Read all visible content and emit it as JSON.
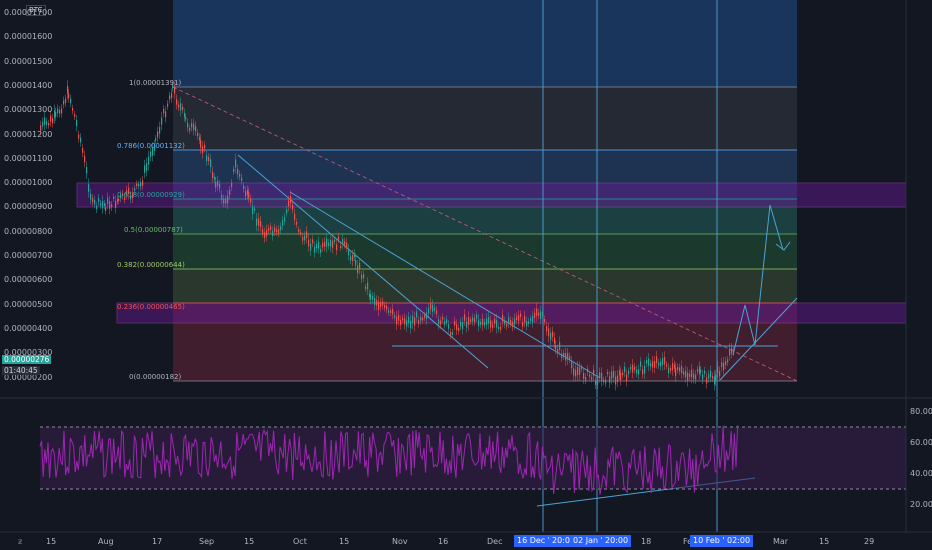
{
  "symbol": "BTC",
  "price_axis": [
    "0.00001700",
    "0.00001600",
    "0.00001500",
    "0.00001400",
    "0.00001300",
    "0.00001200",
    "0.00001100",
    "0.00001000",
    "0.00000900",
    "0.00000800",
    "0.00000700",
    "0.00000600",
    "0.00000500",
    "0.00000400",
    "0.00000300",
    "0.00000200"
  ],
  "current_price": "0.00000276",
  "countdown": "01:40:45",
  "fib_levels": [
    {
      "label": "1(0.00001391)",
      "color": "#b2b5be"
    },
    {
      "label": "0.786(0.00001132)",
      "color": "#5fb5ff"
    },
    {
      "label": "0.618(0.00000929)",
      "color": "#26a69a"
    },
    {
      "label": "0.5(0.00000787)",
      "color": "#66bb6a"
    },
    {
      "label": "0.382(0.00000644)",
      "color": "#9ccc65"
    },
    {
      "label": "0.236(0.00000465)",
      "color": "#ef5350"
    },
    {
      "label": "0(0.00000182)",
      "color": "#b2b5be"
    }
  ],
  "rsi_axis": [
    "80.00",
    "60.00",
    "40.00",
    "20.00"
  ],
  "time_axis": [
    "15",
    "Aug",
    "17",
    "Sep",
    "15",
    "Oct",
    "15",
    "Nov",
    "16",
    "Dec",
    "18",
    "Feb",
    "15",
    "Mar",
    "15",
    "29"
  ],
  "time_tags": [
    "16 Dec '20",
    "20:00",
    "02 Jan '21",
    "20:00",
    "10 Feb '21",
    "02:00"
  ],
  "colors": {
    "background": "#131722",
    "rsi": "#9c27b0",
    "drawing": "#4ba3d8",
    "fib_zone_purple": "#7b1fa2"
  }
}
